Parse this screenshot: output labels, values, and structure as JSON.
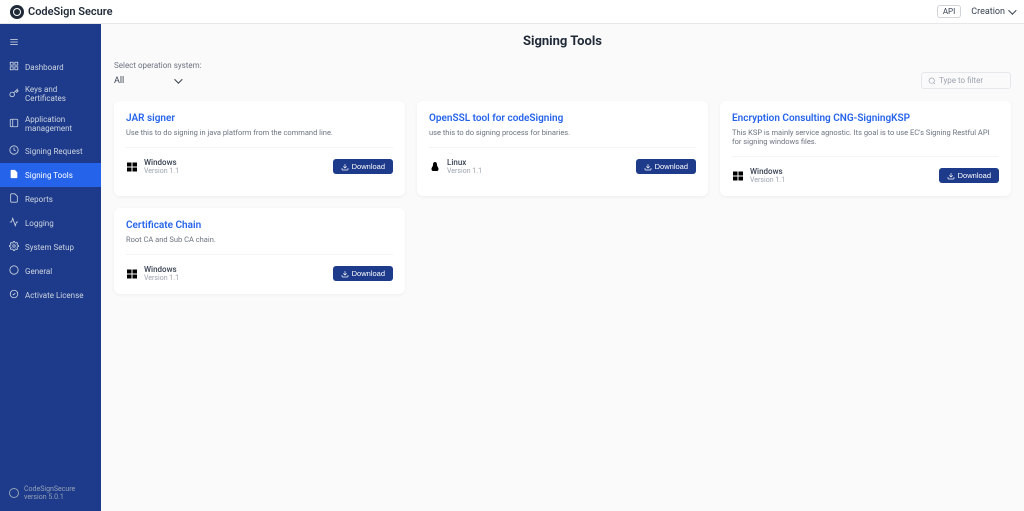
{
  "app_name": "CodeSign Secure",
  "header": {
    "api_badge": "API",
    "user": "Creation"
  },
  "sidebar": {
    "items": [
      {
        "label": "Dashboard",
        "icon": "dashboard"
      },
      {
        "label": "Keys and Certificates",
        "icon": "key"
      },
      {
        "label": "Application management",
        "icon": "apps"
      },
      {
        "label": "Signing Request",
        "icon": "request"
      },
      {
        "label": "Signing Tools",
        "icon": "tools",
        "active": true
      },
      {
        "label": "Reports",
        "icon": "reports"
      },
      {
        "label": "Logging",
        "icon": "logging"
      },
      {
        "label": "System Setup",
        "icon": "setup"
      },
      {
        "label": "General",
        "icon": "general"
      },
      {
        "label": "Activate License",
        "icon": "license"
      }
    ],
    "footer_app": "CodeSignSecure",
    "footer_version": "version 5.0.1"
  },
  "page": {
    "title": "Signing Tools",
    "filter_label": "Select operation system:",
    "filter_value": "All",
    "search_placeholder": "Type to filter"
  },
  "cards": [
    {
      "title": "JAR signer",
      "desc": "Use this to do signing in java platform from the command line.",
      "os_name": "Windows",
      "os_version": "Version 1.1",
      "os_icon": "windows",
      "download": "Download"
    },
    {
      "title": "OpenSSL tool for codeSigning",
      "desc": "use this to do signing process for binaries.",
      "os_name": "Linux",
      "os_version": "Version 1.1",
      "os_icon": "linux",
      "download": "Download"
    },
    {
      "title": "Encryption Consulting CNG-SigningKSP",
      "desc": "This KSP is mainly service agnostic. Its goal is to use EC's Signing Restful API for signing windows files.",
      "os_name": "Windows",
      "os_version": "Version 1.1",
      "os_icon": "windows",
      "download": "Download"
    },
    {
      "title": "Certificate Chain",
      "desc": "Root CA and Sub CA chain.",
      "os_name": "Windows",
      "os_version": "Version 1.1",
      "os_icon": "windows",
      "download": "Download"
    }
  ]
}
